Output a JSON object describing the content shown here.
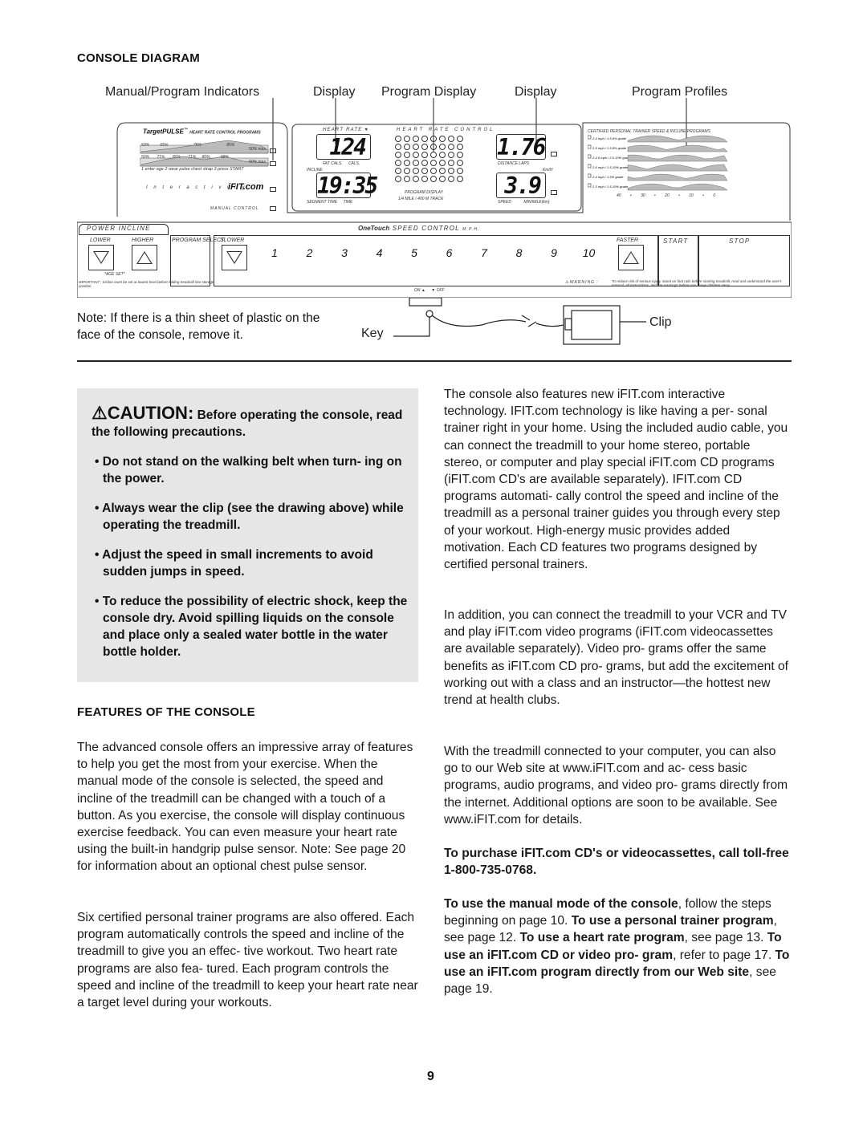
{
  "console_diagram": {
    "heading": "CONSOLE DIAGRAM",
    "callouts": [
      "Manual/Program Indicators",
      "Display",
      "Program Display",
      "Display",
      "Program Profiles"
    ],
    "target_pulse": {
      "title": "TargetPULSE",
      "tm": "™",
      "subtitle": "HEART RATE CONTROL PROGRAMS",
      "row1_pcts": [
        "50%",
        "65%",
        "75%",
        "85%",
        "50% max."
      ],
      "row2_pcts": [
        "50%",
        "71%",
        "80%",
        "71%",
        "80%",
        "68%",
        "50% max."
      ],
      "instruction": "1 enter age  2 wear pulse chest strap  3 press START",
      "interactivity": "I n t e r a c t i v i t y",
      "ifit_logo": "iFIT.com",
      "manual_control": "MANUAL CONTROL"
    },
    "display_left": {
      "heart_rate_label": "HEART RATE",
      "heart_value": "124",
      "fat_cals": "FAT CALS.",
      "cals": "CALS.",
      "incline_label": "INCLINE",
      "time_value": "19:35",
      "segment_time": "SEGMENT TIME",
      "time": "TIME"
    },
    "program_display": {
      "top_label": "HEART RATE CONTROL",
      "bottom_label": "PROGRAM DISPLAY",
      "track_label": "1/4 MILE / 400 M TRACK"
    },
    "display_right": {
      "distance_value": "1.76",
      "distance_laps": "DISTANCE LAPS",
      "kmh": "Km/H",
      "speed_value": "3.9",
      "speed": "SPEED",
      "pace": "MIN/MILE(km)"
    },
    "profiles": {
      "title": "CERTIFIED PERSONAL TRAINER SPEED & INCLINE PROGRAMS",
      "rows": [
        "2-4 mph / 1.5-6% grade",
        "2-5 mph / 1.5-8% grade",
        "2-4.5 mph / 2.5-10% grade",
        "2-6 mph / 1.5-10% grade",
        "2-4 mph / 1.5% grade",
        "2-3 mph / 1.5-10% grade"
      ],
      "scale": [
        "40",
        "•",
        "30",
        "•",
        "20",
        "•",
        "10",
        "•",
        "0"
      ]
    },
    "controls": {
      "power_incline": "POWER INCLINE",
      "lower": "LOWER",
      "higher": "HIGHER",
      "program_select": "PROGRAM SELECT",
      "age_set": "*AGE SET*",
      "onetouch": "OneTouch",
      "speed_control": "SPEED CONTROL",
      "mph": "M.P.H.",
      "slower": "SLOWER",
      "speed_keys": [
        "1",
        "2",
        "3",
        "4",
        "5",
        "6",
        "7",
        "8",
        "9",
        "10"
      ],
      "faster": "FASTER",
      "start": "START",
      "stop": "STOP",
      "important": "IMPORTANT : Incline must be set at lowest level before folding treadmill into storage position.",
      "on": "ON ▲",
      "off": "▼ OFF",
      "warning_label": "WARNING :",
      "warning_text": "To reduce risk of serious injury, stand on foot rails before starting treadmill, read and understand the user's manual, all instructions, and the warnings before use.  Keep children away"
    },
    "note": "Note: If there is a thin sheet of plastic on the face of the console, remove it.",
    "key_label": "Key",
    "clip_label": "Clip"
  },
  "caution": {
    "word": "CAUTION:",
    "lead": "Before operating the console, read the following precautions.",
    "bullets": [
      "Do not stand on the walking belt when turn- ing on the power.",
      "Always wear the clip (see the drawing above) while operating the treadmill.",
      "Adjust the speed in small increments to avoid sudden jumps in speed.",
      "To reduce the possibility of electric shock, keep the console dry. Avoid spilling liquids on the console and place only a sealed water bottle in the water bottle holder."
    ]
  },
  "features": {
    "heading": "FEATURES OF THE CONSOLE",
    "p1": "The advanced console offers an impressive array of features to help you get the most from your exercise. When the manual mode of the console is selected, the speed and incline of the treadmill can be changed with a touch of a button. As you exercise, the console will display continuous exercise feedback. You can even measure your heart rate using the built-in handgrip pulse sensor. Note: See page 20 for information about an optional chest pulse sensor.",
    "p2": "Six certified personal trainer programs are also offered. Each program automatically controls the speed and incline of the treadmill to give you an effec- tive workout. Two heart rate programs are also fea- tured. Each program controls the speed and incline of the treadmill to keep your heart rate near a target level during your workouts."
  },
  "right_column": {
    "p1": "The console also features new iFIT.com interactive technology. IFIT.com technology is like having a per- sonal trainer right in your home. Using the included audio cable, you can connect the treadmill to your home stereo, portable stereo, or computer and play special iFIT.com CD programs (iFIT.com CD's are available separately). IFIT.com CD programs automati- cally control the speed and incline of the treadmill as a personal trainer guides you through every step of your workout. High-energy music provides added motivation. Each CD features two programs designed by certified personal trainers.",
    "p2": "In addition, you can connect the treadmill to your VCR and TV and play iFIT.com video programs (iFIT.com videocassettes are available separately). Video pro- grams offer the same benefits as iFIT.com CD pro- grams, but add the excitement of working out with a class and an instructor—the hottest new trend at health clubs.",
    "p3": "With the treadmill connected to your computer, you can also go to our Web site at www.iFIT.com and ac- cess basic programs, audio programs, and video pro- grams directly from the internet. Additional options are soon to be available. See www.iFIT.com for details.",
    "p4": "To purchase iFIT.com CD's or videocassettes, call toll-free 1-800-735-0768.",
    "p5_parts": [
      {
        "b": "To use the manual mode of the console",
        "t": ", follow the steps beginning on page 10. "
      },
      {
        "b": "To use a personal trainer program",
        "t": ", see page 12. "
      },
      {
        "b": "To use a heart rate program",
        "t": ", see page 13. "
      },
      {
        "b": "To use an iFIT.com CD or video pro- gram",
        "t": ", refer to page 17. "
      },
      {
        "b": "To use an iFIT.com program directly from our Web site",
        "t": ", see page 19."
      }
    ]
  },
  "page_number": "9"
}
